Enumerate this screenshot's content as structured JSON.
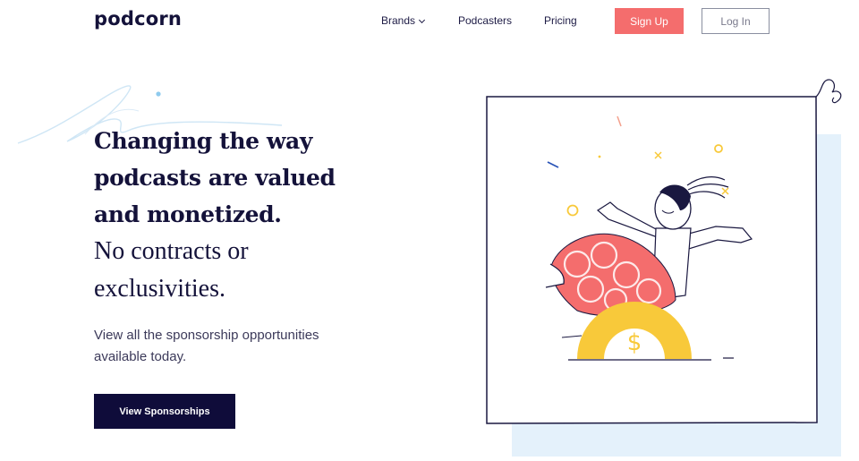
{
  "header": {
    "logo": "podcorn",
    "nav": [
      {
        "label": "Brands",
        "has_dropdown": true
      },
      {
        "label": "Podcasters"
      },
      {
        "label": "Pricing"
      }
    ],
    "signup_label": "Sign Up",
    "login_label": "Log In"
  },
  "hero": {
    "title": "Changing the way podcasts are valued and monetized.",
    "subtitle": "No contracts or exclusivities.",
    "description": "View all the sponsorship opportunities available today.",
    "cta_label": "View Sponsorships",
    "coin_symbol": "$"
  },
  "colors": {
    "brand_navy": "#0f0c3a",
    "accent_coral": "#f46d6d",
    "accent_yellow": "#f8c93a",
    "light_blue": "#e4f1fb"
  },
  "icons": [
    "chevron-down-icon",
    "dollar-coin-icon",
    "confetti-icon"
  ]
}
